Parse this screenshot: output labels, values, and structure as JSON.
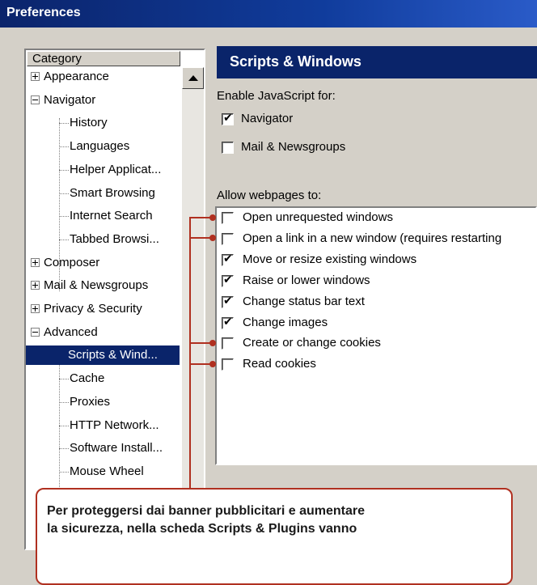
{
  "window": {
    "title": "Preferences"
  },
  "tree": {
    "header": "Category",
    "items": [
      {
        "label": "Appearance",
        "expander": "plus"
      },
      {
        "label": "Navigator",
        "expander": "minus"
      },
      {
        "label": "History"
      },
      {
        "label": "Languages"
      },
      {
        "label": "Helper Applicat..."
      },
      {
        "label": "Smart Browsing"
      },
      {
        "label": "Internet Search"
      },
      {
        "label": "Tabbed Browsi..."
      },
      {
        "label": "Composer",
        "expander": "plus"
      },
      {
        "label": "Mail & Newsgroups",
        "expander": "plus"
      },
      {
        "label": "Privacy & Security",
        "expander": "plus"
      },
      {
        "label": "Advanced",
        "expander": "minus"
      },
      {
        "label": "Scripts & Wind...",
        "selected": true
      },
      {
        "label": "Cache"
      },
      {
        "label": "Proxies"
      },
      {
        "label": "HTTP Network..."
      },
      {
        "label": "Software Install..."
      },
      {
        "label": "Mouse Wheel"
      }
    ]
  },
  "panel": {
    "title": "Scripts & Windows",
    "enable_js_label": "Enable JavaScript for:",
    "enable_js": [
      {
        "label": "Navigator",
        "checked": true
      },
      {
        "label": "Mail & Newsgroups",
        "checked": false
      }
    ],
    "allow_label": "Allow webpages to:",
    "allow": [
      {
        "label": "Open unrequested windows",
        "checked": false
      },
      {
        "label": "Open a link in a new window (requires restarting",
        "checked": false
      },
      {
        "label": "Move or resize existing windows",
        "checked": true
      },
      {
        "label": "Raise or lower windows",
        "checked": true
      },
      {
        "label": "Change status bar text",
        "checked": true
      },
      {
        "label": "Change images",
        "checked": true
      },
      {
        "label": "Create or change cookies",
        "checked": false
      },
      {
        "label": "Read cookies",
        "checked": false
      }
    ]
  },
  "callout": {
    "line1": "Per proteggersi dai banner pubblicitari e aumentare",
    "line2": "la sicurezza, nella scheda Scripts & Plugins vanno"
  },
  "colors": {
    "selection": "#0a246a",
    "annotation": "#b03020"
  }
}
